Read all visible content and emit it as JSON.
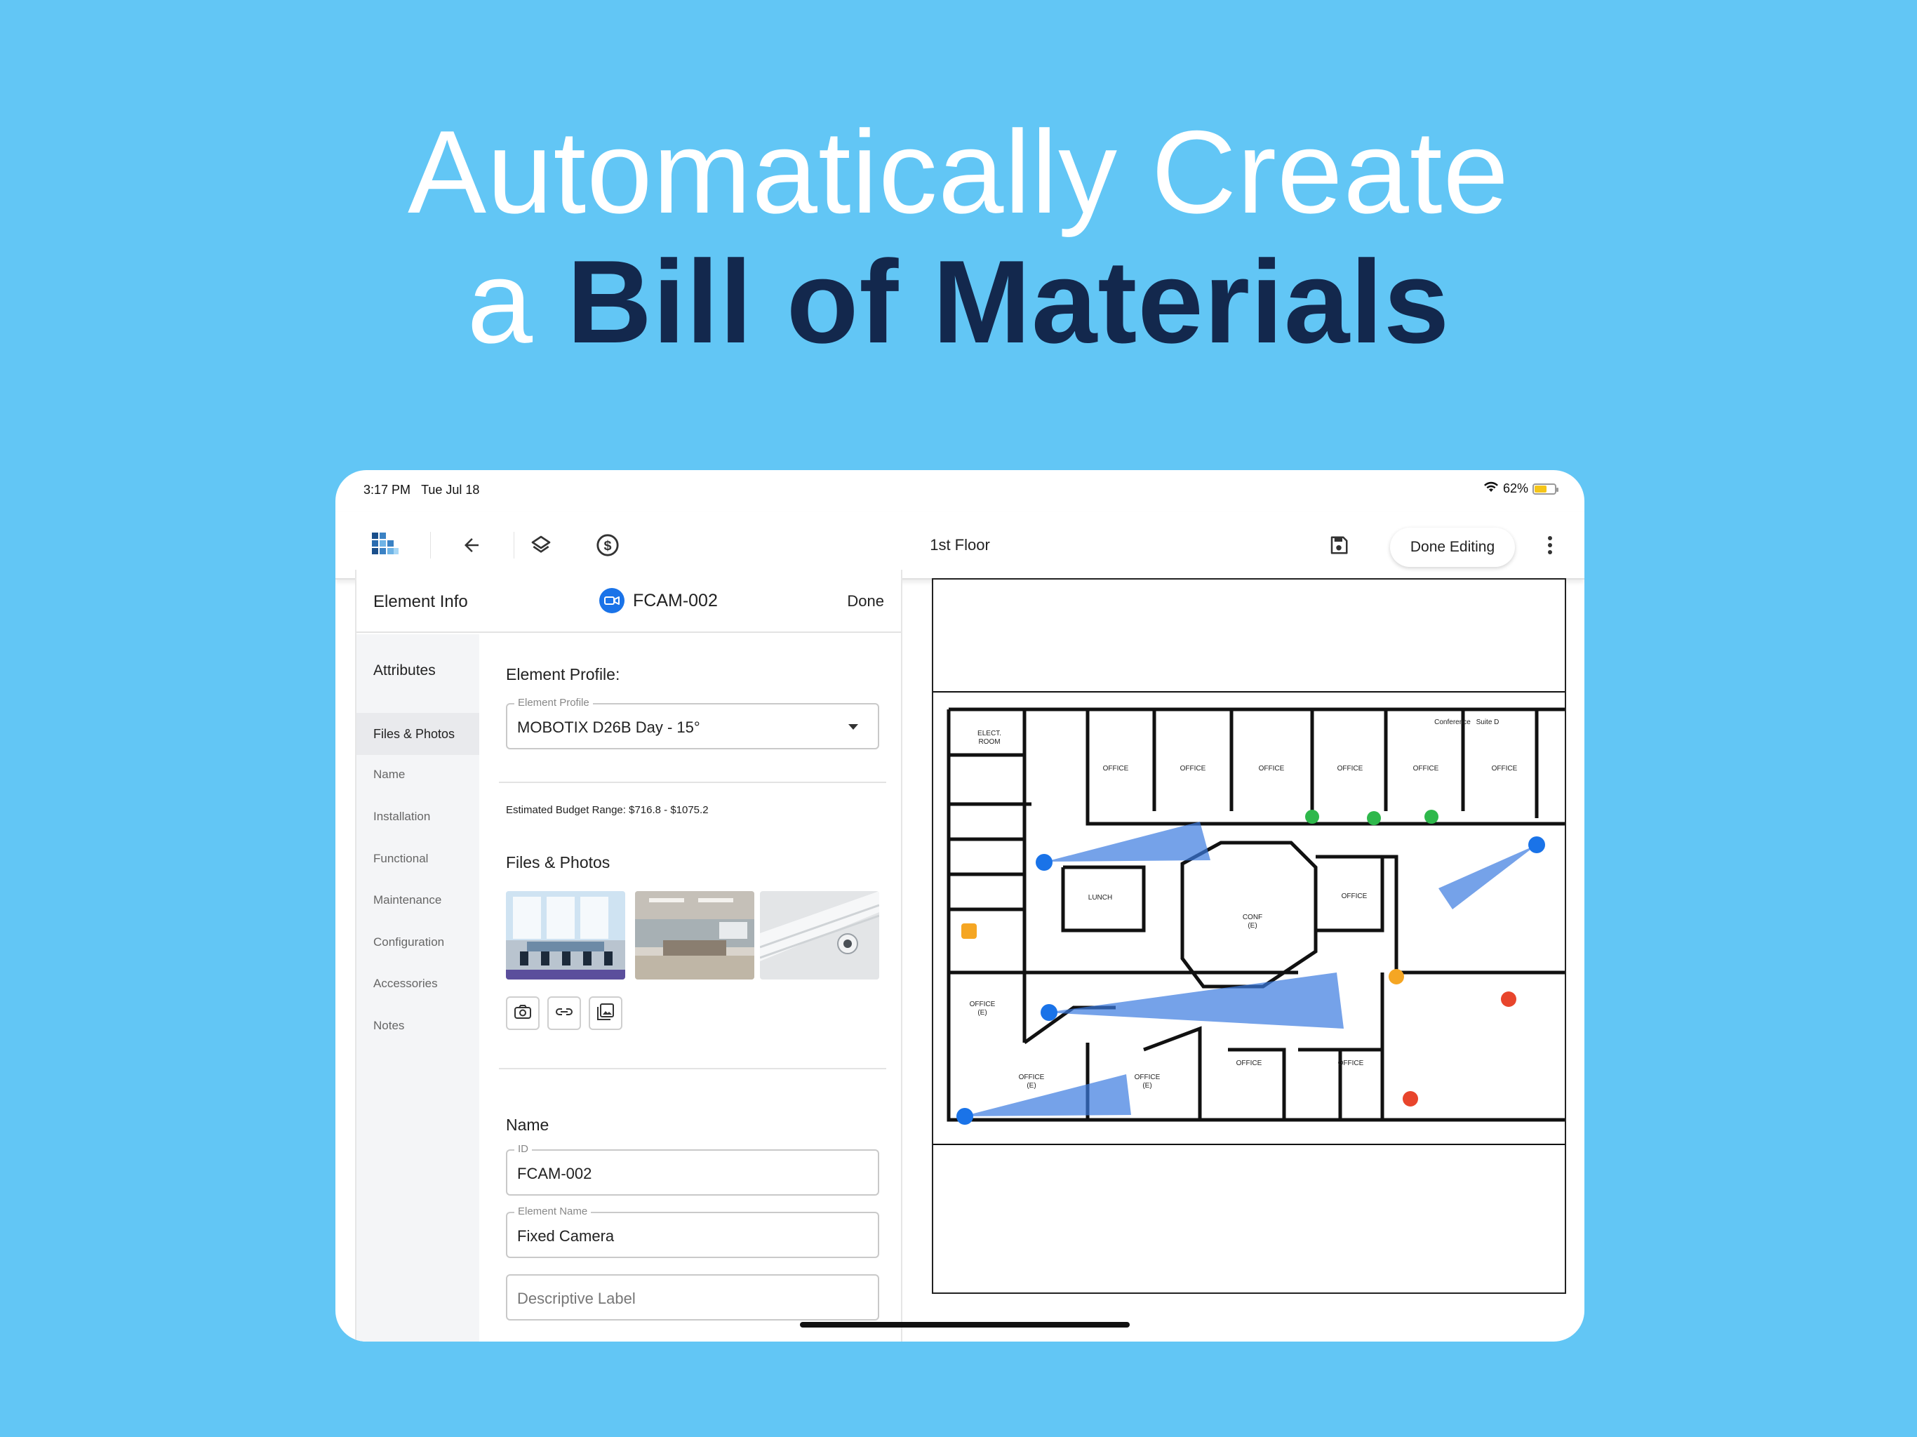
{
  "headline": {
    "line1": "Automatically Create",
    "line2_prefix": "a ",
    "line2_bold": "Bill of Materials"
  },
  "status_bar": {
    "time": "3:17 PM",
    "date": "Tue Jul 18",
    "battery": "62%",
    "battery_level": 0.62,
    "battery_color": "#f5c518"
  },
  "toolbar": {
    "title": "1st Floor",
    "done_editing_label": "Done Editing",
    "icons": [
      "app-logo-icon",
      "back-arrow-icon",
      "layers-icon",
      "dollar-icon",
      "save-icon",
      "more-vert-icon"
    ]
  },
  "panel": {
    "header_title": "Element Info",
    "element_id": "FCAM-002",
    "done_label": "Done",
    "nav": {
      "attributes": "Attributes",
      "items": [
        "Files & Photos",
        "Name",
        "Installation",
        "Functional",
        "Maintenance",
        "Configuration",
        "Accessories",
        "Notes"
      ]
    },
    "profile_section_title": "Element Profile:",
    "profile_field_label": "Element Profile",
    "profile_value": "MOBOTIX D26B Day - 15°",
    "budget_text": "Estimated Budget Range: $716.8 - $1075.2",
    "files_section_title": "Files & Photos",
    "name_section_title": "Name",
    "id_label": "ID",
    "id_value": "FCAM-002",
    "element_name_label": "Element Name",
    "element_name_value": "Fixed Camera",
    "descriptive_label_placeholder": "Descriptive Label"
  },
  "colors": {
    "background": "#62c6f5",
    "headline_bold": "#13284d",
    "accent_blue": "#1a73e8",
    "camera_cone": "#3a7be0"
  }
}
